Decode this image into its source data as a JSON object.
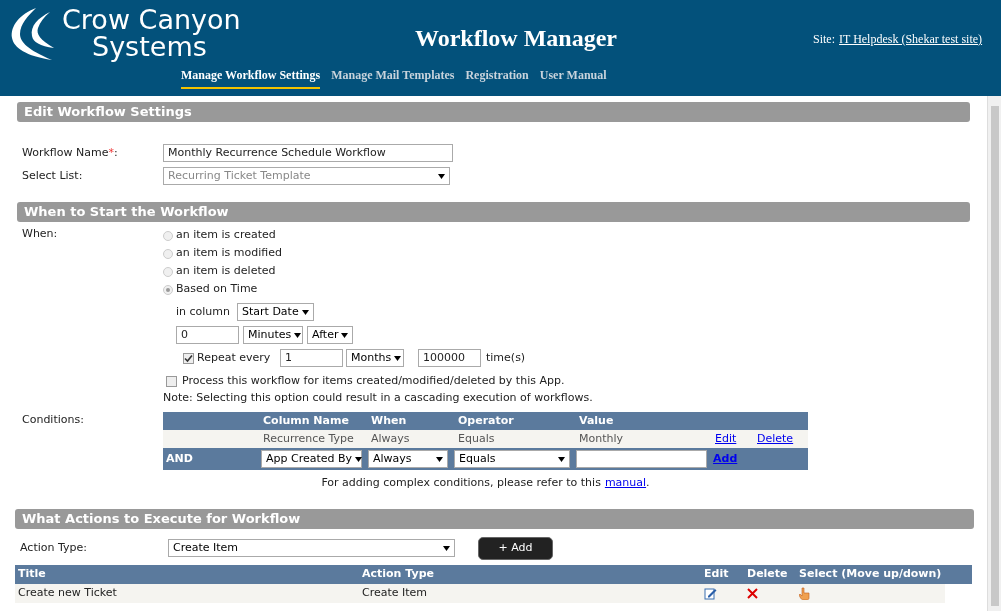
{
  "header": {
    "logo_lines": [
      "Crow Canyon",
      "Systems"
    ],
    "title": "Workflow Manager",
    "site_label": "Site:",
    "site_link": "IT Helpdesk (Shekar test site)",
    "nav": [
      {
        "label": "Manage Workflow Settings",
        "selected": true
      },
      {
        "label": "Manage Mail Templates",
        "selected": false
      },
      {
        "label": "Registration",
        "selected": false
      },
      {
        "label": "User Manual",
        "selected": false
      }
    ]
  },
  "edit_settings": {
    "title": "Edit Workflow Settings",
    "name_label": "Workflow Name",
    "required_mark": "*",
    "name_suffix": ":",
    "name_value": "Monthly Recurrence Schedule Workflow",
    "list_label": "Select List:",
    "list_value": "Recurring Ticket Template"
  },
  "start": {
    "title": "When to Start the Workflow",
    "when_label": "When:",
    "options": [
      {
        "label": "an item is created",
        "selected": false
      },
      {
        "label": "an item is modified",
        "selected": false
      },
      {
        "label": "an item is deleted",
        "selected": false
      },
      {
        "label": "Based on Time",
        "selected": true
      }
    ],
    "in_column_label": "in column",
    "column_value": "Start Date",
    "offset_value": "0",
    "offset_unit": "Minutes",
    "offset_direction": "After",
    "repeat": {
      "checked": true,
      "label": "Repeat every",
      "value": "1",
      "unit": "Months",
      "count": "100000",
      "suffix": "time(s)"
    },
    "process": {
      "checked": false,
      "label": "Process this workflow for items created/modified/deleted by this App.",
      "note": "Note: Selecting this option could result in a cascading execution of workflows."
    }
  },
  "conditions": {
    "label": "Conditions:",
    "columns": [
      "Column Name",
      "When",
      "Operator",
      "Value"
    ],
    "rows": [
      {
        "column_name": "Recurrence Type",
        "when": "Always",
        "operator": "Equals",
        "value": "Monthly",
        "edit": "Edit",
        "delete": "Delete"
      }
    ],
    "new_row": {
      "joiner": "AND",
      "column": "App Created By",
      "when": "Always",
      "operator": "Equals",
      "add": "Add"
    },
    "hint_text": "For adding complex conditions, please refer to this",
    "hint_link": "manual",
    "hint_end": "."
  },
  "actions": {
    "title": "What Actions to Execute for Workflow",
    "type_label": "Action Type:",
    "type_value": "Create Item",
    "add_button": "+ Add",
    "columns": [
      "Title",
      "Action Type",
      "Edit",
      "Delete",
      "Select (Move up/down)"
    ],
    "rows": [
      {
        "title": "Create new Ticket",
        "action_type": "Create Item"
      }
    ]
  }
}
